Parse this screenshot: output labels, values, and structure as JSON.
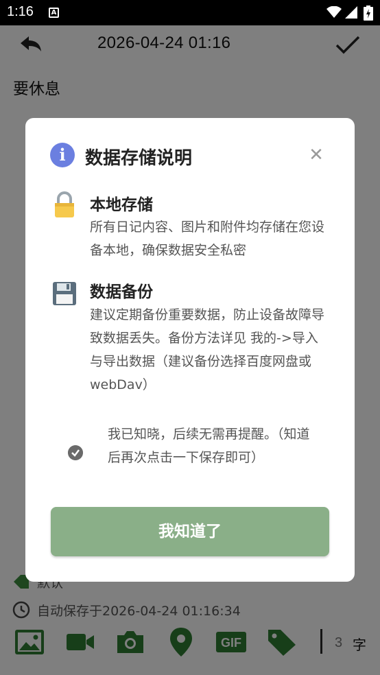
{
  "status_bar": {
    "time": "1:16",
    "notification_icon": "A"
  },
  "editor": {
    "datetime": "2026-04-24   01:16",
    "note_text": "要休息",
    "tag_label": "默认",
    "autosave_text": "自动保存于2026-04-24 01:16:34",
    "toolbar_icons": [
      "image-icon",
      "video-icon",
      "camera-icon",
      "location-icon",
      "gif-icon",
      "tag-icon"
    ],
    "char_count": "3",
    "char_unit": "字"
  },
  "dialog": {
    "title": "数据存储说明",
    "sections": [
      {
        "icon": "lock-icon",
        "title": "本地存储",
        "body": "所有日记内容、图片和附件均存储在您设备本地，确保数据安全私密"
      },
      {
        "icon": "floppy-disk-icon",
        "title": "数据备份",
        "body": "建议定期备份重要数据，防止设备故障导致数据丢失。备份方法详见 我的->导入与导出数据（建议备份选择百度网盘或webDav）"
      }
    ],
    "acknowledge_text": "我已知晓，后续无需再提醒。（知道后再次点击一下保存即可）",
    "ok_button": "我知道了"
  },
  "colors": {
    "accent_button": "#8aaf88",
    "info_icon": "#6b7fe0",
    "scrim": "rgba(0,0,0,0.5)"
  }
}
